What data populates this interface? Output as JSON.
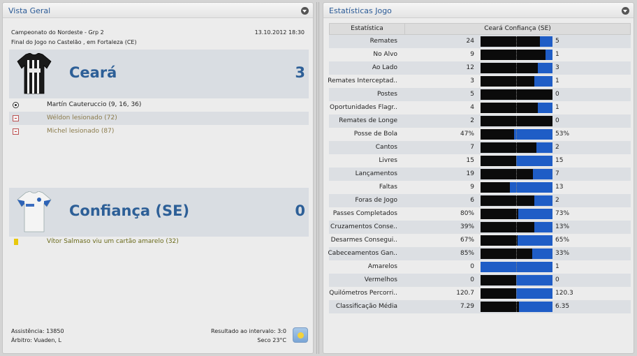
{
  "overview": {
    "title": "Vista Geral",
    "competition": "Campeonato do Nordeste - Grp 2",
    "datetime": "13.10.2012 18:30",
    "venue": "Final do Jogo no Castelão , em Fortaleza (CE)",
    "home": {
      "name": "Ceará",
      "score": "3",
      "events": [
        {
          "icon": "goal-ball-icon",
          "text": "Martín Cauteruccio (9, 16, 36)",
          "color": "#222222"
        },
        {
          "icon": "injury-icon",
          "text": "Wéldon lesionado (72)",
          "color": "#8a7a4a"
        },
        {
          "icon": "injury-icon",
          "text": "Michel lesionado (87)",
          "color": "#8a7a4a"
        }
      ]
    },
    "away": {
      "name": "Confiança (SE)",
      "score": "0",
      "events": [
        {
          "icon": "yellow-card-icon",
          "text": "Vítor Salmaso viu um cartão amarelo (32)",
          "color": "#6a6a1a"
        }
      ]
    },
    "attendance": "Assistência: 13850",
    "referee": "Árbitro: Vuaden, L",
    "halftime": "Resultado ao intervalo: 3:0",
    "weather": "Seco 23°C",
    "weather_icon": "sunny-weather-icon"
  },
  "stats": {
    "title": "Estatísticas Jogo",
    "header_stat": "Estatística",
    "header_teams": "Ceará  Confiança (SE)",
    "colors": {
      "home_bar": "#0b0b0b",
      "away_bar": "#1f5dc6"
    },
    "rows": [
      {
        "label": "Remates",
        "home": "24",
        "away": "5",
        "away_share": 0.17
      },
      {
        "label": "No Alvo",
        "home": "9",
        "away": "1",
        "away_share": 0.1
      },
      {
        "label": "Ao Lado",
        "home": "12",
        "away": "3",
        "away_share": 0.2
      },
      {
        "label": "Remates Interceptad..",
        "home": "3",
        "away": "1",
        "away_share": 0.25
      },
      {
        "label": "Postes",
        "home": "5",
        "away": "0",
        "away_share": 0
      },
      {
        "label": "Oportunidades Flagr..",
        "home": "4",
        "away": "1",
        "away_share": 0.2
      },
      {
        "label": "Remates de Longe",
        "home": "2",
        "away": "0",
        "away_share": 0
      },
      {
        "label": "Posse de Bola",
        "home": "47%",
        "away": "53%",
        "away_share": 0.53
      },
      {
        "label": "Cantos",
        "home": "7",
        "away": "2",
        "away_share": 0.22
      },
      {
        "label": "Livres",
        "home": "15",
        "away": "15",
        "away_share": 0.5
      },
      {
        "label": "Lançamentos",
        "home": "19",
        "away": "7",
        "away_share": 0.27
      },
      {
        "label": "Faltas",
        "home": "9",
        "away": "13",
        "away_share": 0.59
      },
      {
        "label": "Foras de Jogo",
        "home": "6",
        "away": "2",
        "away_share": 0.25
      },
      {
        "label": "Passes Completados",
        "home": "80%",
        "away": "73%",
        "away_share": 0.48
      },
      {
        "label": "Cruzamentos Conse..",
        "home": "39%",
        "away": "13%",
        "away_share": 0.25
      },
      {
        "label": "Desarmes Consegui..",
        "home": "67%",
        "away": "65%",
        "away_share": 0.49
      },
      {
        "label": "Cabeceamentos Gan..",
        "home": "85%",
        "away": "33%",
        "away_share": 0.28
      },
      {
        "label": "Amarelos",
        "home": "0",
        "away": "1",
        "away_share": 1
      },
      {
        "label": "Vermelhos",
        "home": "0",
        "away": "0",
        "away_share": 0.5
      },
      {
        "label": "Quilómetros Percorri..",
        "home": "120.7",
        "away": "120.3",
        "away_share": 0.5
      },
      {
        "label": "Classificação Média",
        "home": "7.29",
        "away": "6.35",
        "away_share": 0.47
      }
    ]
  }
}
